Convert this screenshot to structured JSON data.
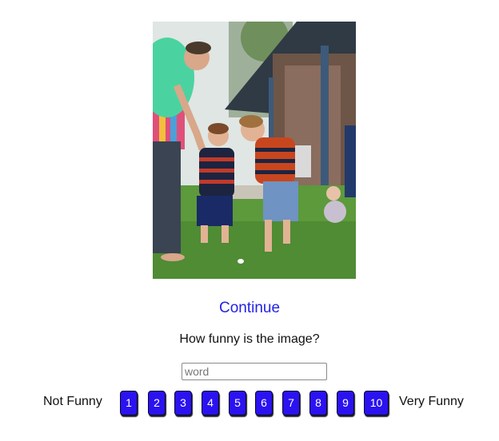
{
  "image": {
    "description_icon": "photo-icon"
  },
  "continue_label": "Continue",
  "question": "How funny is the image?",
  "word_input": {
    "value": "",
    "placeholder": "word"
  },
  "scale": {
    "low_label": "Not Funny",
    "high_label": "Very Funny",
    "options": [
      "1",
      "2",
      "3",
      "4",
      "5",
      "6",
      "7",
      "8",
      "9",
      "10"
    ]
  },
  "colors": {
    "link": "#2323e6",
    "button": "#2b12f0",
    "button_text": "#ffffff"
  }
}
